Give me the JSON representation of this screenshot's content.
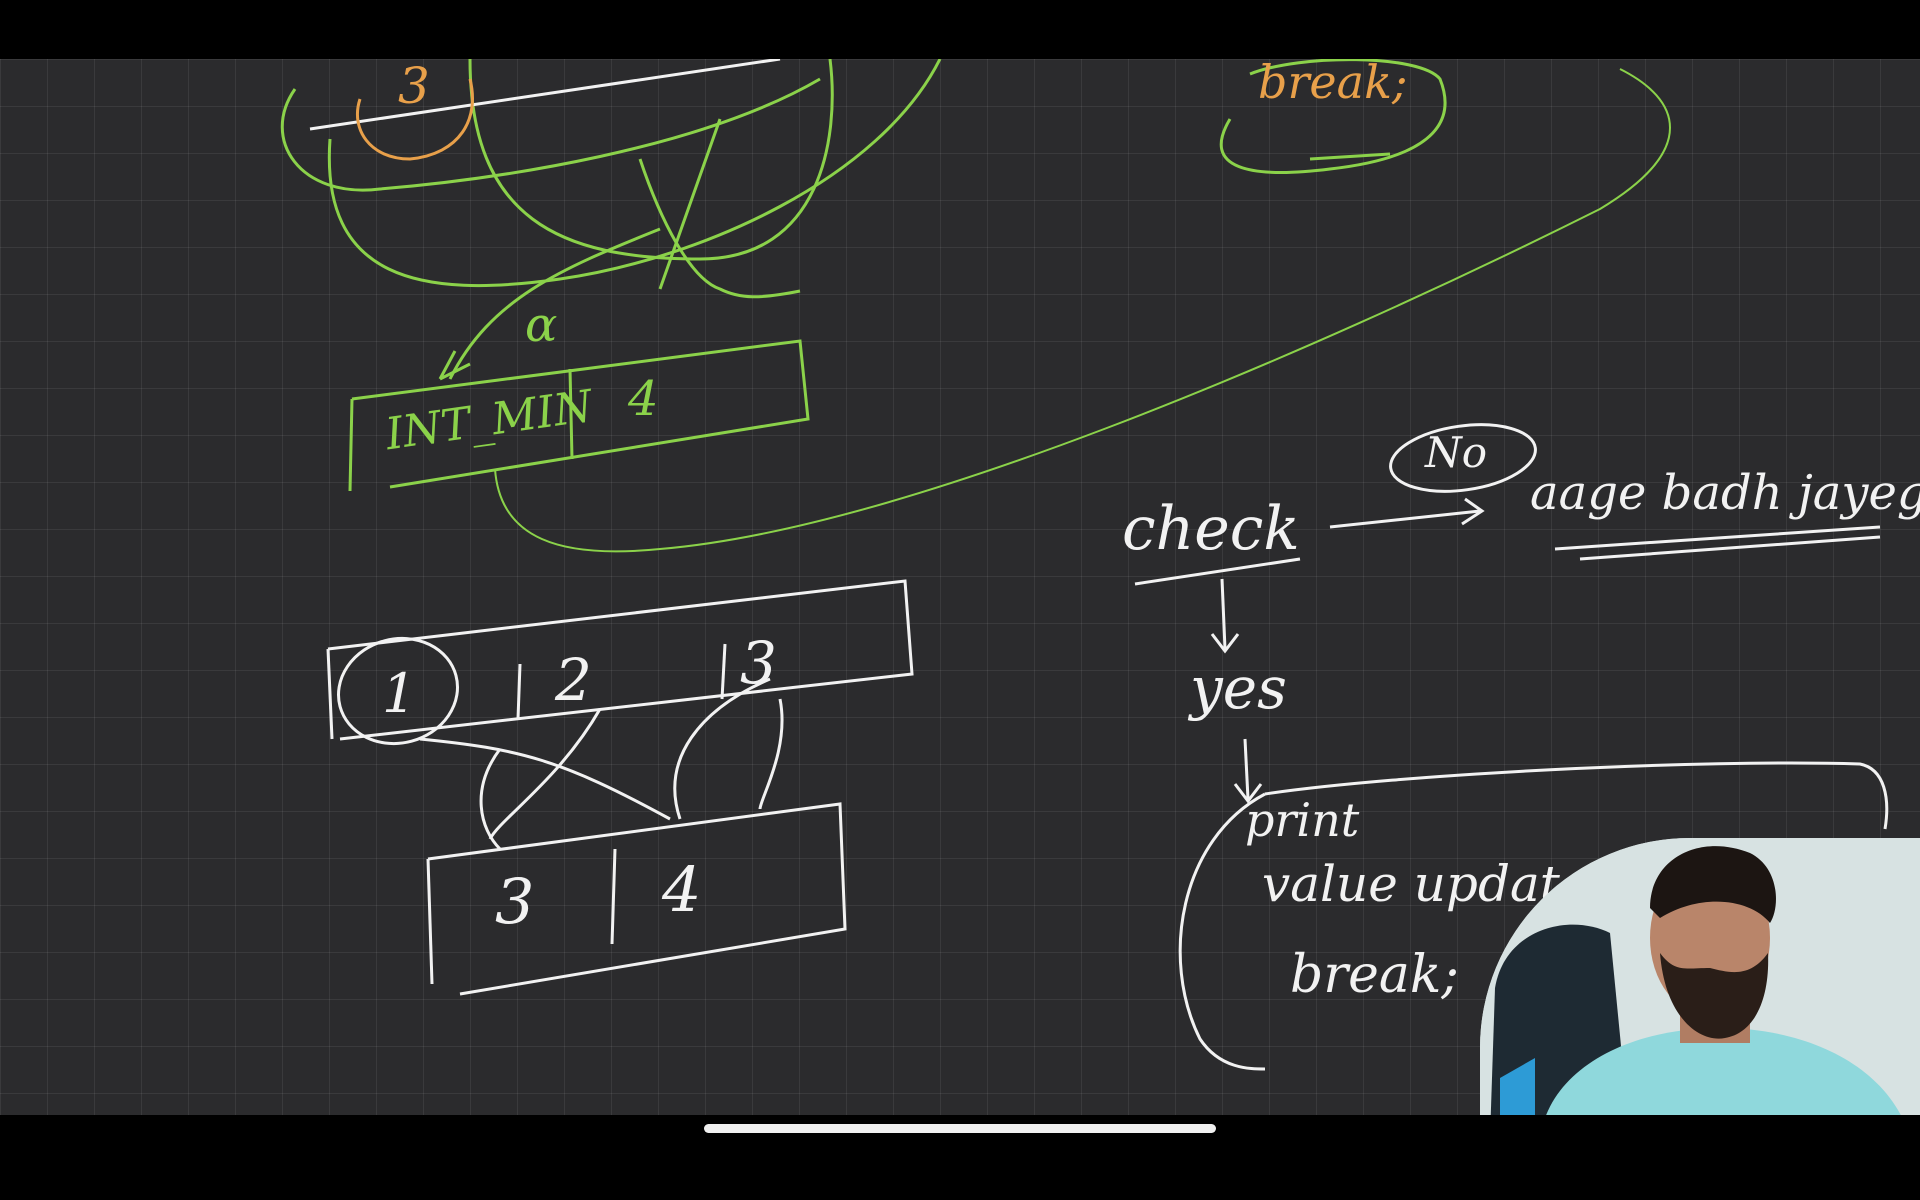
{
  "canvas": {
    "colors": {
      "background": "#2b2b2d",
      "grid": "#3a3a3d",
      "ink_white": "#f2f2f2",
      "ink_green": "#8bd24a",
      "ink_orange": "#e8a04a"
    }
  },
  "notes": {
    "top_circled_digit": "3",
    "top_right_break": "break;",
    "alpha": "α",
    "int_min_label": "INT_MIN",
    "int_min_value": "4",
    "array_top": [
      "1",
      "2",
      "3"
    ],
    "array_bottom": [
      "3",
      "4"
    ],
    "check": "check",
    "no": "No",
    "aage_badh_jayega": "aage badh jayega",
    "yes": "yes",
    "print": "print",
    "value_update": "value update",
    "break_bottom": "break;"
  },
  "webcam": {
    "icon": "presenter-webcam-icon"
  }
}
